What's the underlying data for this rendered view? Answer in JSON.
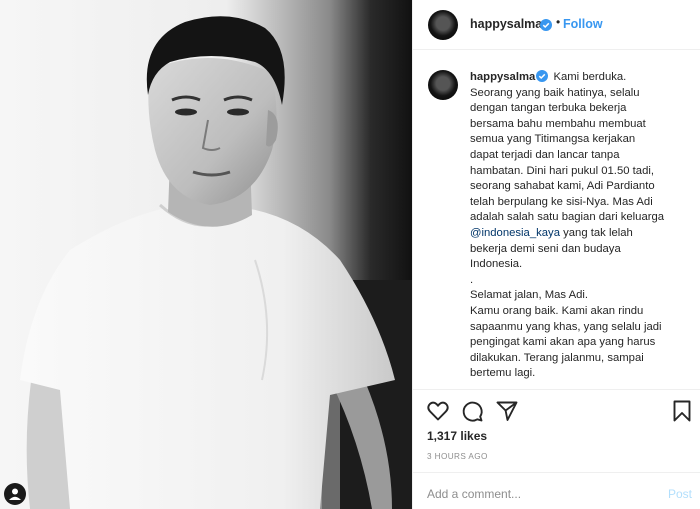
{
  "post": {
    "username": "happysalma",
    "follow_label": "Follow",
    "separator": "•",
    "caption_lines": [
      "Kami berduka.",
      "Seorang yang baik hatinya, selalu",
      "dengan tangan terbuka bekerja",
      "bersama bahu membahu membuat",
      "semua yang Titimangsa kerjakan",
      "dapat terjadi dan lancar tanpa",
      "hambatan. Dini hari pukul 01.50 tadi,",
      "seorang sahabat kami, Adi Pardianto",
      "telah berpulang ke sisi-Nya. Mas Adi",
      "adalah salah satu bagian dari keluarga",
      "yang tak lelah",
      "bekerja demi seni dan budaya",
      "Indonesia.",
      ".",
      "Selamat jalan, Mas Adi.",
      "Kamu orang baik. Kami akan rindu",
      "sapaanmu yang khas, yang selalu jadi",
      "pengingat kami akan apa yang harus",
      "dilakukan. Terang jalanmu, sampai",
      "bertemu lagi."
    ],
    "mention": "@indonesia_kaya",
    "likes": "1,317 likes",
    "time": "3 HOURS AGO",
    "comment_placeholder": "Add a comment...",
    "post_label": "Post"
  },
  "icons": {
    "like": "heart-icon",
    "comment": "comment-icon",
    "share": "paper-plane-icon",
    "save": "bookmark-icon",
    "tags": "user-tag-icon",
    "verified": "verified-badge-icon"
  },
  "colors": {
    "link": "#3897f0",
    "mention": "#003569",
    "verified": "#3897f0",
    "post_disabled": "#b2dffc",
    "muted": "#8e8e8e",
    "text": "#262626"
  }
}
